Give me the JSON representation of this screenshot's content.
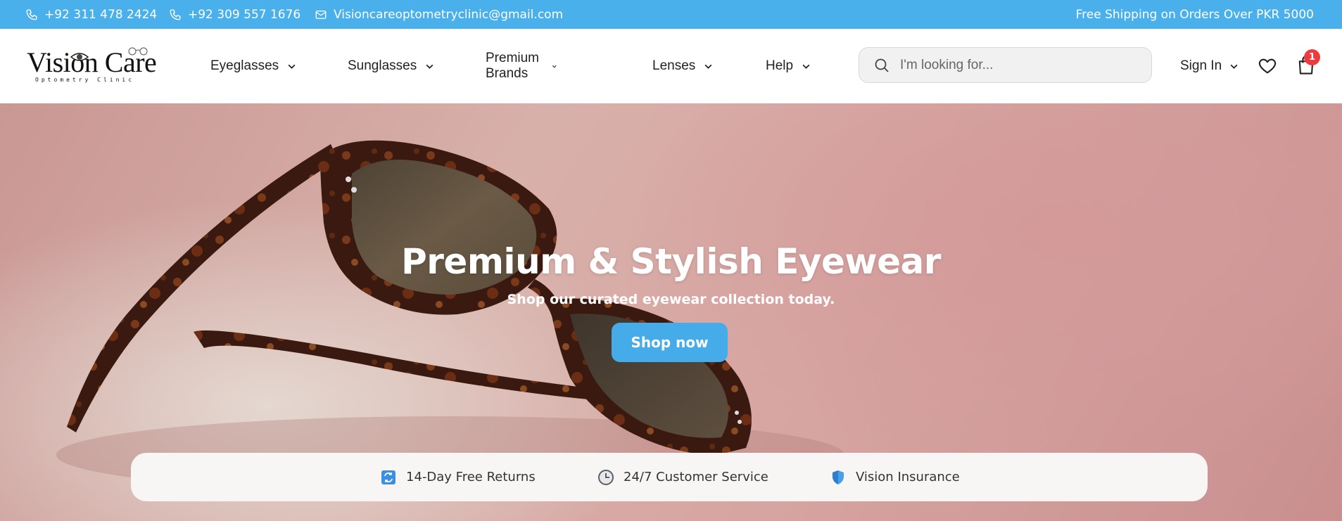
{
  "topbar": {
    "phone1": "+92 311 478 2424",
    "phone2": "+92 309 557 1676",
    "email": "Visioncareoptometryclinic@gmail.com",
    "shipping": "Free Shipping on Orders Over PKR 5000",
    "icons": [
      "phone-icon",
      "phone-icon",
      "mail-icon"
    ]
  },
  "logo": {
    "name": "Vision Care",
    "tagline": "Optometry Clinic"
  },
  "nav": {
    "items": [
      {
        "label": "Eyeglasses"
      },
      {
        "label": "Sunglasses"
      },
      {
        "label": "Premium Brands"
      },
      {
        "label": "Lenses"
      },
      {
        "label": "Help"
      }
    ]
  },
  "search": {
    "placeholder": "I'm looking for...",
    "value": ""
  },
  "account": {
    "signin_label": "Sign In",
    "cart_count": "1"
  },
  "hero": {
    "title": "Premium & Stylish Eyewear",
    "subtitle": "Shop our curated eyewear collection today.",
    "cta": "Shop now"
  },
  "features": [
    {
      "label": "14-Day Free Returns",
      "icon": "returns-icon"
    },
    {
      "label": "24/7 Customer Service",
      "icon": "clock-icon"
    },
    {
      "label": "Vision Insurance",
      "icon": "shield-icon"
    }
  ],
  "colors": {
    "accent": "#49b0ec",
    "badge": "#ee3a3f"
  }
}
